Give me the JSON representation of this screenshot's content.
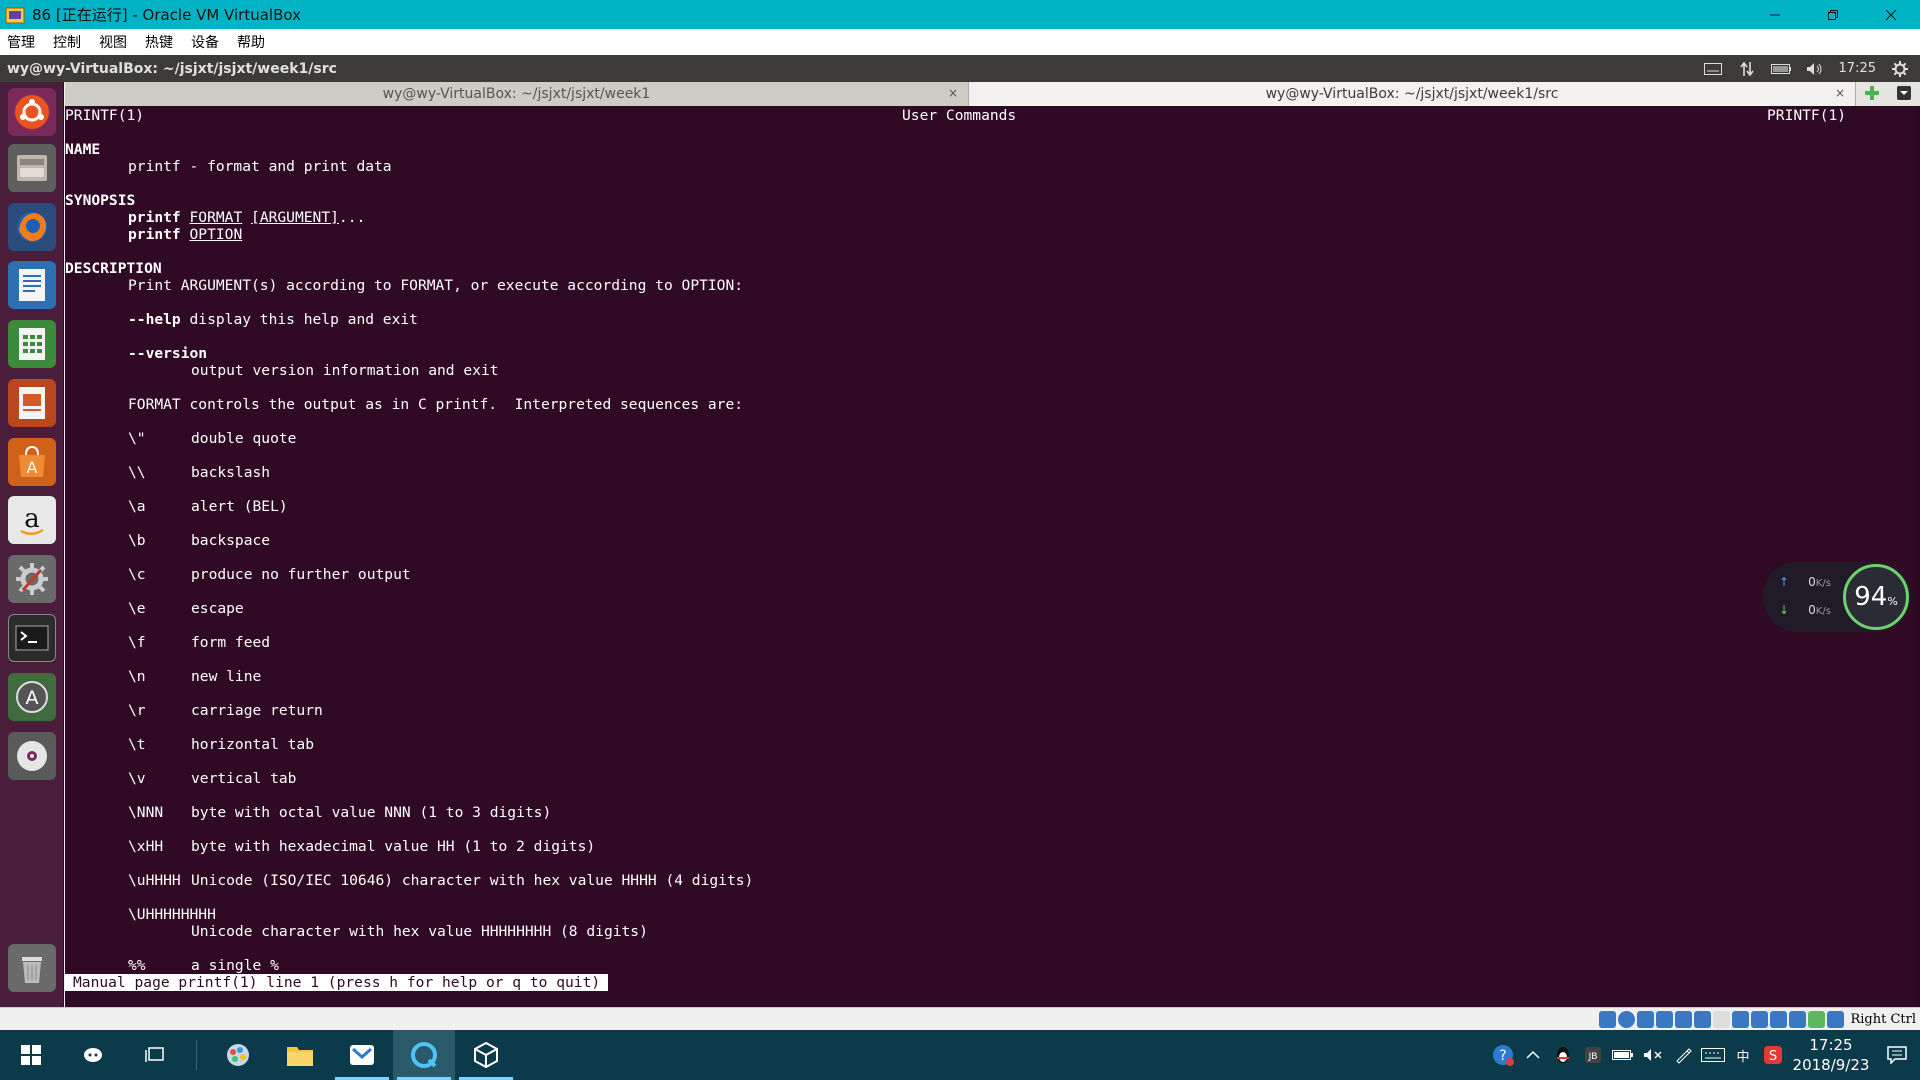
{
  "vbox": {
    "title": "86 [正在运行] - Oracle VM VirtualBox",
    "menu": [
      "管理",
      "控制",
      "视图",
      "热键",
      "设备",
      "帮助"
    ],
    "status_hostkey": "Right Ctrl"
  },
  "ubuntu_panel": {
    "title": "wy@wy-VirtualBox: ~/jsjxt/jsjxt/week1/src",
    "time": "17:25"
  },
  "launcher": {
    "items": [
      "ubuntu-dash",
      "files",
      "firefox",
      "libreoffice-writer",
      "libreoffice-calc",
      "libreoffice-impress",
      "ubuntu-software",
      "amazon",
      "system-settings",
      "terminal",
      "software-updater",
      "dvd",
      "trash"
    ]
  },
  "terminal": {
    "tabs": [
      {
        "title": "wy@wy-VirtualBox: ~/jsjxt/jsjxt/week1",
        "active": false
      },
      {
        "title": "wy@wy-VirtualBox: ~/jsjxt/jsjxt/week1/src",
        "active": true
      }
    ],
    "header_left": "PRINTF(1)",
    "header_center": "User Commands",
    "header_right": "PRINTF(1)",
    "name_heading": "NAME",
    "name_line": "printf - format and print data",
    "synopsis_heading": "SYNOPSIS",
    "synopsis": {
      "cmd": "printf",
      "format": "FORMAT",
      "argument": "[ARGUMENT]",
      "ellipsis": "...",
      "option": "OPTION"
    },
    "description_heading": "DESCRIPTION",
    "desc_line": "Print ARGUMENT(s) according to FORMAT, or execute according to OPTION:",
    "help_flag": "--help",
    "help_text": "display this help and exit",
    "version_flag": "--version",
    "version_text": "output version information and exit",
    "format_line": "FORMAT controls the output as in C printf.  Interpreted sequences are:",
    "sequences": [
      {
        "seq": "\\\"",
        "desc": "double quote"
      },
      {
        "seq": "\\\\",
        "desc": "backslash"
      },
      {
        "seq": "\\a",
        "desc": "alert (BEL)"
      },
      {
        "seq": "\\b",
        "desc": "backspace"
      },
      {
        "seq": "\\c",
        "desc": "produce no further output"
      },
      {
        "seq": "\\e",
        "desc": "escape"
      },
      {
        "seq": "\\f",
        "desc": "form feed"
      },
      {
        "seq": "\\n",
        "desc": "new line"
      },
      {
        "seq": "\\r",
        "desc": "carriage return"
      },
      {
        "seq": "\\t",
        "desc": "horizontal tab"
      },
      {
        "seq": "\\v",
        "desc": "vertical tab"
      },
      {
        "seq": "\\NNN",
        "desc": "byte with octal value NNN (1 to 3 digits)"
      },
      {
        "seq": "\\xHH",
        "desc": "byte with hexadecimal value HH (1 to 2 digits)"
      },
      {
        "seq": "\\uHHHH",
        "desc": "Unicode (ISO/IEC 10646) character with hex value HHHH (4 digits)"
      }
    ],
    "long_seq": "\\UHHHHHHHH",
    "long_seq_desc": "Unicode character with hex value HHHHHHHH (8 digits)",
    "percent_seq": "%%",
    "percent_desc": "a single %",
    "status": "Manual page printf(1) line 1 (press h for help or q to quit)"
  },
  "net_widget": {
    "up_rate": "0",
    "down_rate": "0",
    "unit": "K/s",
    "percent": "94",
    "percent_sign": "%"
  },
  "win_taskbar": {
    "clock_time": "17:25",
    "clock_date": "2018/9/23",
    "ime": "中"
  },
  "colors": {
    "terminal_bg": "#300a24",
    "vbox_title_bg": "#00b4c6",
    "launcher_bg": "#4a1e3a",
    "taskbar_bg": "#0b3a4a"
  }
}
